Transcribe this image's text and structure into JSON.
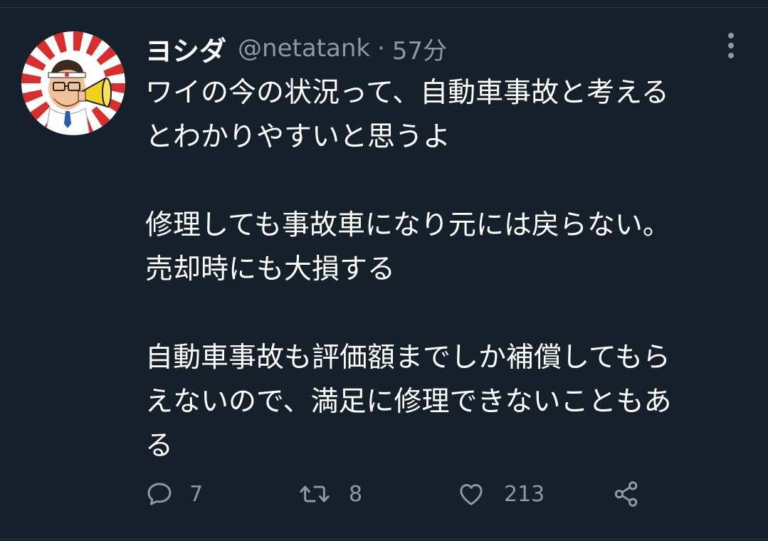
{
  "tweet": {
    "display_name": "ヨシダ",
    "handle": "@netatank",
    "separator": "·",
    "time": "57分",
    "paragraphs": [
      "ワイの今の状況って、自動車事故と考える\nとわかりやすいと思うよ",
      "修理しても事故車になり元には戻らない。\n売却時にも大損する",
      "自動車事故も評価額までしか補償してもら\nえないので、満足に修理できないこともあ\nる"
    ]
  },
  "actions": {
    "reply_count": "7",
    "retweet_count": "8",
    "like_count": "213"
  },
  "icons": {
    "reply": "reply-icon",
    "retweet": "retweet-icon",
    "like": "heart-icon",
    "share": "share-icon",
    "more": "more-vertical-icon"
  },
  "colors": {
    "background": "#15202b",
    "text": "#ffffff",
    "secondary_text": "#8b98a5",
    "avatar_ray_red": "#d92e2e"
  }
}
